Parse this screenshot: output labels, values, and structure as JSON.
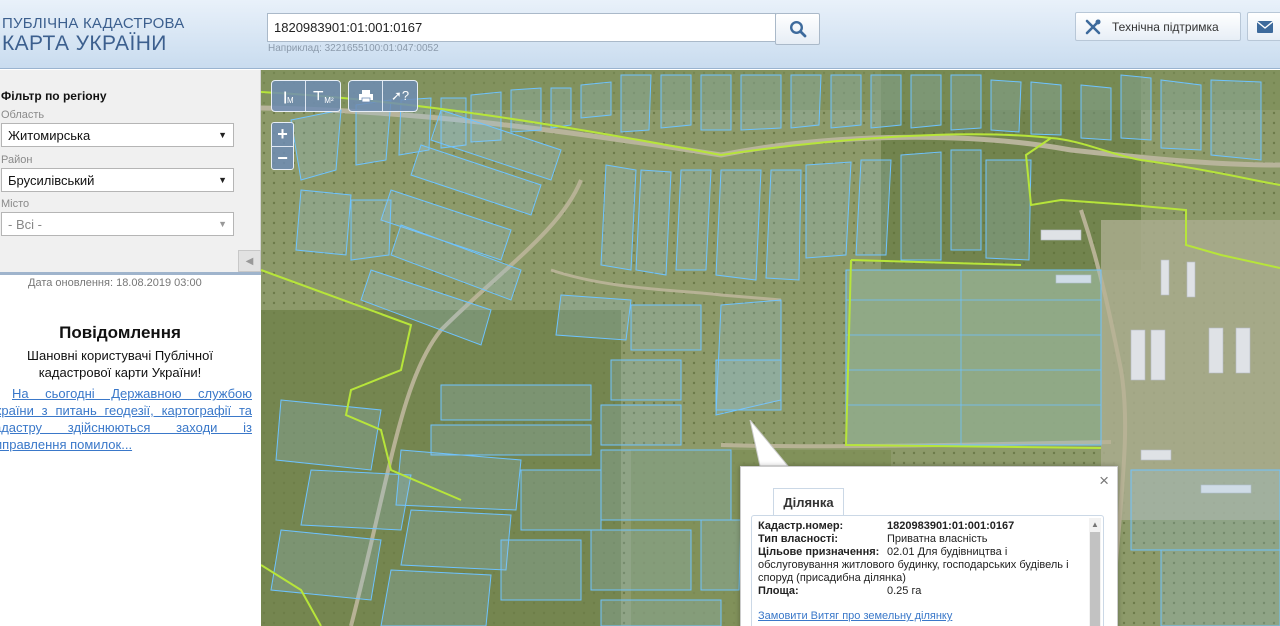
{
  "header": {
    "logo_line1": "ПУБЛІЧНА КАДАСТРОВА",
    "logo_line2": "КАРТА УКРАЇНИ",
    "search_value": "1820983901:01:001:0167",
    "example_text": "Наприклад: 3221655100:01:047:0052",
    "support_label": "Технічна підтримка"
  },
  "filter": {
    "title": "Фільтр по регіону",
    "oblast_label": "Область",
    "oblast_value": "Житомирська",
    "rayon_label": "Район",
    "rayon_value": "Брусилівський",
    "misto_label": "Місто",
    "misto_value": "- Всі -"
  },
  "updated": "Дата оновлення: 18.08.2019 03:00",
  "notice": {
    "title": "Повідомлення",
    "text": "Шановні користувачі Публічної кадастрової карти України!",
    "link": "На сьогодні Державною службою України з питань геодезії, картографії та кадастру здійснюються заходи із виправлення помилок..."
  },
  "map_tools": {
    "measure_length": "M",
    "measure_area": "M²"
  },
  "popup": {
    "tab": "Ділянка",
    "cadastral_label": "Кадастр.номер:",
    "cadastral_value": "1820983901:01:001:0167",
    "ownership_label": "Тип власності:",
    "ownership_value": "Приватна власність",
    "purpose_label": "Цільове призначення:",
    "purpose_value_line1": "02.01 Для будівництва і",
    "purpose_value_rest": "обслуговування житлового будинку, господарських будівель і споруд (присадибна ділянка)",
    "area_label": "Площа:",
    "area_value": "0.25 га",
    "order_link": "Замовити Витяг про земельну ділянку"
  },
  "colors": {
    "parcel_border": "#6ec3ff",
    "boundary_line": "#b7e53a",
    "link": "#3a78c9",
    "logo": "#3c5f8e"
  }
}
